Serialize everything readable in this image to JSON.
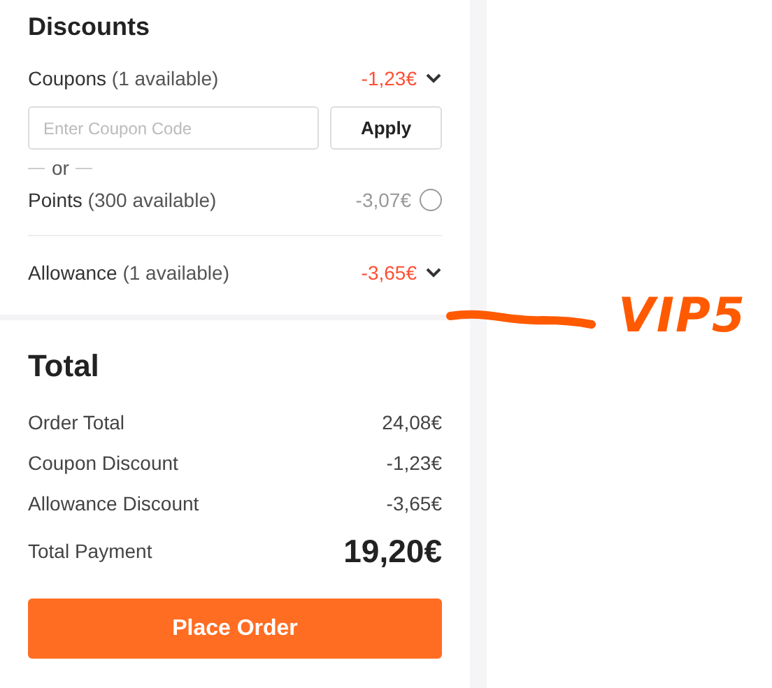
{
  "discounts": {
    "title": "Discounts",
    "options": [
      {
        "kind": "dropdown",
        "label": "Coupons",
        "note": "(1 available)",
        "amount": "-1,23€",
        "applied": true,
        "coupon_field": {
          "placeholder": "Enter Coupon Code",
          "button": "Apply"
        },
        "separator": "or"
      },
      {
        "kind": "radio",
        "label": "Points",
        "note": "(300 available)",
        "amount": "-3,07€",
        "applied": false,
        "selected": false
      },
      {
        "kind": "dropdown",
        "label": "Allowance",
        "note": "(1 available)",
        "amount": "-3,65€",
        "applied": true
      }
    ]
  },
  "total": {
    "title": "Total",
    "lines": [
      {
        "label": "Order Total",
        "value": "24,08€"
      },
      {
        "label": "Coupon Discount",
        "value": "-1,23€"
      },
      {
        "label": "Allowance Discount",
        "value": "-3,65€"
      }
    ],
    "payment": {
      "label": "Total Payment",
      "value": "19,20€"
    },
    "button": "Place Order"
  },
  "annotation": {
    "text": "VIP5"
  }
}
